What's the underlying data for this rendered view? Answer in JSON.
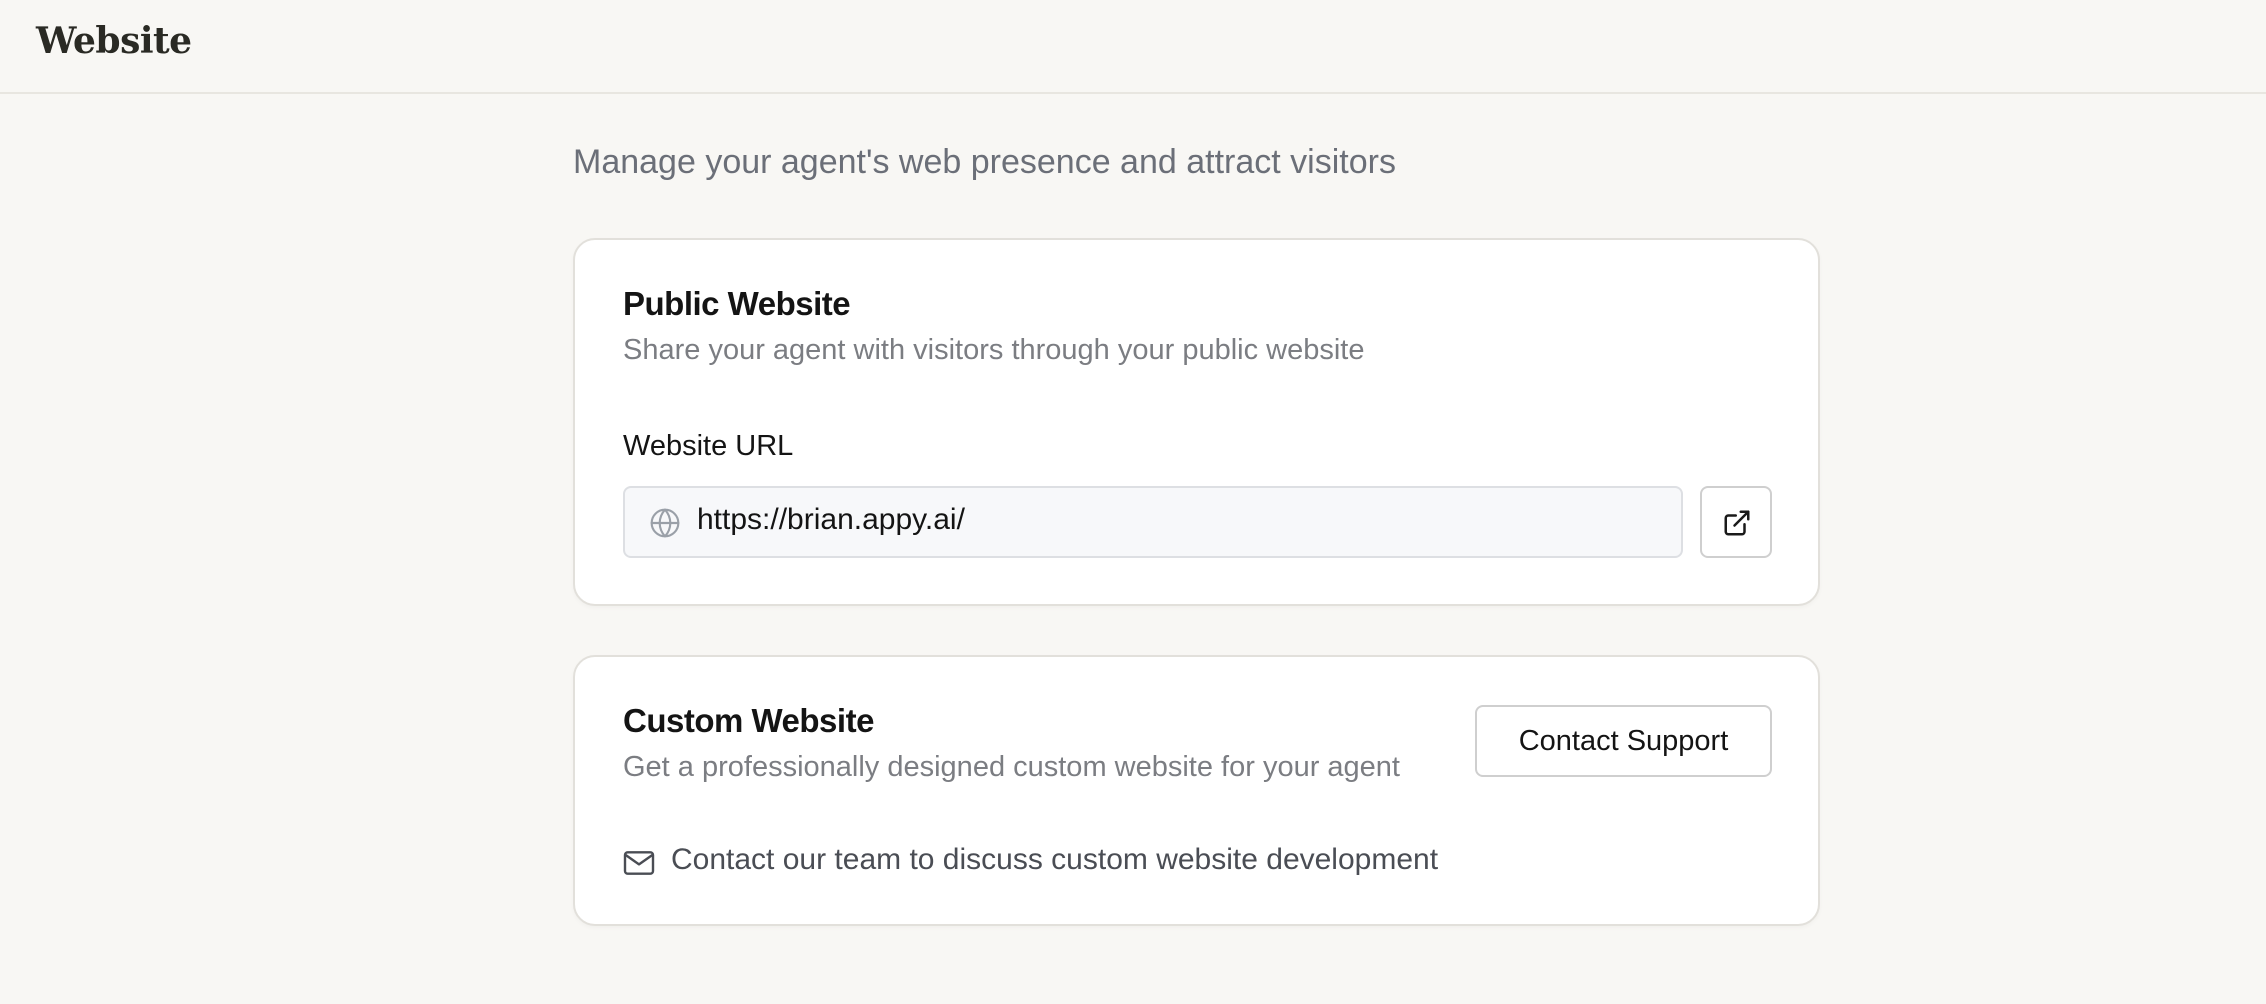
{
  "header": {
    "title": "Website"
  },
  "main": {
    "subtitle": "Manage your agent's web presence and attract visitors",
    "public_website": {
      "title": "Public Website",
      "description": "Share your agent with visitors through your public website",
      "url_label": "Website URL",
      "url_value": "https://brian.appy.ai/",
      "url_icon": "globe-icon",
      "open_icon": "external-link-icon"
    },
    "custom_website": {
      "title": "Custom Website",
      "description": "Get a professionally designed custom website for your agent",
      "button_label": "Contact Support",
      "info_text": "Contact our team to discuss custom website development",
      "info_icon": "mail-icon"
    }
  },
  "colors": {
    "background": "#f8f7f4",
    "card": "#ffffff",
    "border": "#e2e0db",
    "muted_text": "#7b7d82"
  }
}
